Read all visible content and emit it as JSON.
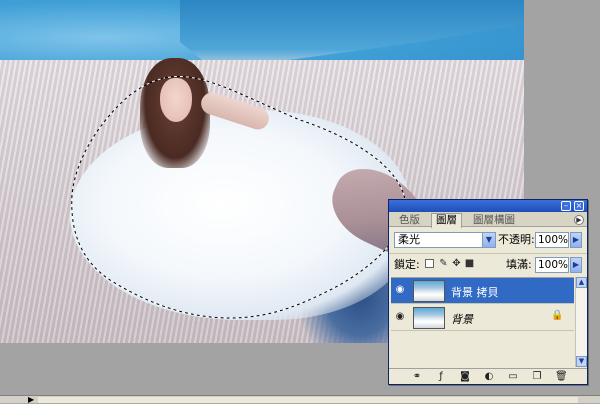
{
  "canvas": {
    "content": "photo"
  },
  "panel": {
    "tabs": [
      {
        "label": "色版",
        "active": false
      },
      {
        "label": "圖層",
        "active": true
      },
      {
        "label": "圖層構圖",
        "active": false
      }
    ],
    "blend_mode": "柔光",
    "opacity_label": "不透明:",
    "opacity_value": "100%",
    "lock_label": "鎖定:",
    "fill_label": "填滿:",
    "fill_value": "100%",
    "layers": [
      {
        "name": "背景 拷貝",
        "selected": true,
        "visible": true,
        "locked": false
      },
      {
        "name": "背景",
        "selected": false,
        "visible": true,
        "locked": true
      }
    ],
    "bottom_icons": [
      "link-icon",
      "layer-style-icon",
      "mask-icon",
      "adjustment-icon",
      "group-folder-icon",
      "new-layer-icon",
      "trash-icon"
    ]
  },
  "colors": {
    "selected_layer": "#316ac5",
    "titlebar": "#1f4fb8"
  }
}
